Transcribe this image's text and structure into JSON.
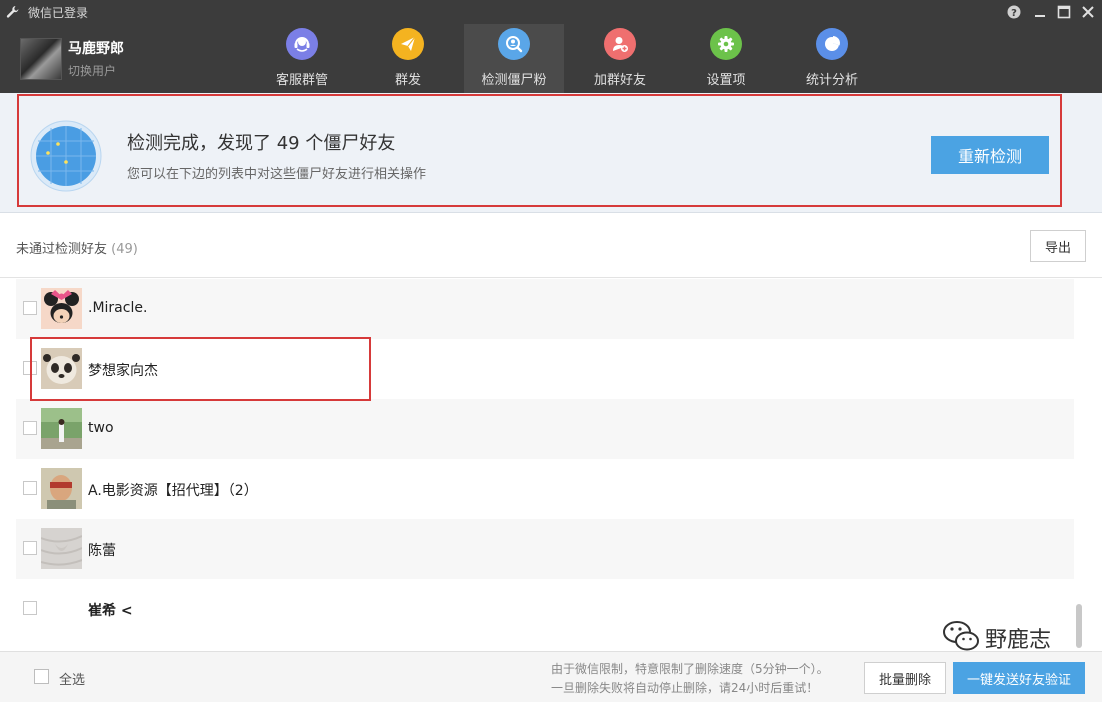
{
  "window": {
    "title": "微信已登录"
  },
  "user": {
    "name": "马鹿野郎",
    "switch_label": "切换用户"
  },
  "nav": {
    "tabs": [
      {
        "label": "客服群管",
        "color": "#7b7fe6",
        "icon": "headset-icon"
      },
      {
        "label": "群发",
        "color": "#f4b320",
        "icon": "paper-plane-icon"
      },
      {
        "label": "检测僵尸粉",
        "color": "#5aa6e8",
        "icon": "search-user-icon",
        "active": true
      },
      {
        "label": "加群好友",
        "color": "#ef6f6f",
        "icon": "add-user-icon"
      },
      {
        "label": "设置项",
        "color": "#6cc24a",
        "icon": "gear-icon"
      },
      {
        "label": "统计分析",
        "color": "#5b8fe8",
        "icon": "pie-chart-icon"
      }
    ]
  },
  "banner": {
    "title": "检测完成，发现了 49 个僵尸好友",
    "subtitle": "您可以在下边的列表中对这些僵尸好友进行相关操作",
    "recheck_label": "重新检测"
  },
  "list": {
    "title": "未通过检测好友",
    "count": "(49)",
    "export_label": "导出",
    "friends": [
      {
        "name": ".Miracle.",
        "avatar": "minnie-mouse-avatar"
      },
      {
        "name": "梦想家向杰",
        "avatar": "panda-avatar"
      },
      {
        "name": "two",
        "avatar": "outdoor-photo-avatar"
      },
      {
        "name": "A.电影资源【招代理】（2）",
        "avatar": "person-photo-avatar"
      },
      {
        "name": "陈蕾",
        "avatar": "fabric-avatar"
      },
      {
        "name": "崔希 <",
        "avatar": "blank-avatar"
      }
    ]
  },
  "footer": {
    "select_all_label": "全选",
    "note_line1": "由于微信限制，特意限制了删除速度（5分钟一个）。",
    "note_line2": "一旦删除失败将自动停止删除，请24小时后重试！",
    "batch_delete_label": "批量删除",
    "send_verify_label": "一键发送好友验证"
  },
  "watermark": {
    "text": "野鹿志"
  }
}
